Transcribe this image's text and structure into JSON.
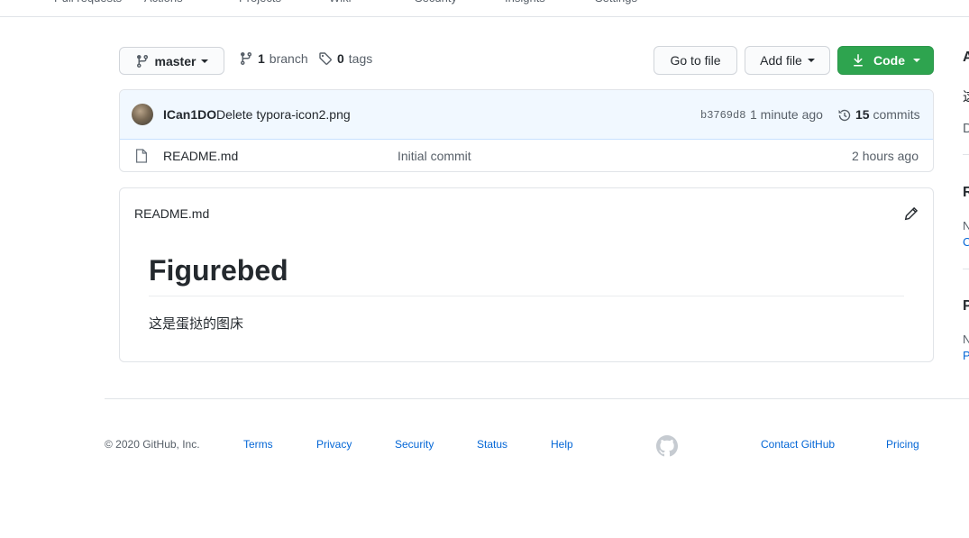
{
  "top_nav": {
    "items": [
      "Pull requests",
      "Actions",
      "Projects",
      "Wiki",
      "Security",
      "Insights",
      "Settings"
    ]
  },
  "toolbar": {
    "branch_name": "master",
    "branches_count": "1",
    "branches_label": "branch",
    "tags_count": "0",
    "tags_label": "tags",
    "go_to_file": "Go to file",
    "add_file": "Add file",
    "code": "Code"
  },
  "commit": {
    "author": "ICan1DO",
    "message": "Delete typora-icon2.png",
    "sha": "b3769d8",
    "time": "1 minute ago",
    "commits_count": "15",
    "commits_label": "commits"
  },
  "files": [
    {
      "name": "README.md",
      "message": "Initial commit",
      "age": "2 hours ago"
    }
  ],
  "readme": {
    "filename": "README.md",
    "title": "Figurebed",
    "body": "这是蛋挞的图床"
  },
  "footer": {
    "copyright": "© 2020 GitHub, Inc.",
    "links": [
      "Terms",
      "Privacy",
      "Security",
      "Status",
      "Help"
    ],
    "links_right": [
      "Contact GitHub",
      "Pricing"
    ]
  },
  "colors": {
    "primary_green": "#2ea44f",
    "link_blue": "#0366d6",
    "commit_bg": "#f1f8ff"
  }
}
